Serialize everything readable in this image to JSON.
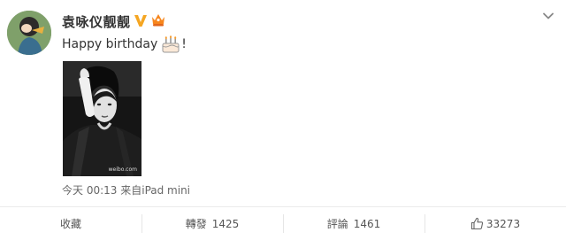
{
  "post": {
    "username": "袁咏仪靓靓",
    "text": "Happy birthday",
    "text_suffix": "!",
    "timestamp": "今天 00:13",
    "source": "来自iPad mini",
    "photo_watermark": "weibo.com"
  },
  "icons": {
    "verified": "verified-v-icon",
    "vip": "crown-vip-icon",
    "menu": "chevron-down-icon",
    "cake": "cake-emoji-icon",
    "like": "thumbs-up-icon"
  },
  "actions": {
    "favorite_label": "收藏",
    "repost_label": "轉發",
    "repost_count": "1425",
    "comment_label": "評論",
    "comment_count": "1461",
    "like_count": "33273"
  },
  "colors": {
    "verified": "#f5a623",
    "vip": "#f7861c",
    "text": "#333333",
    "meta": "#666666"
  }
}
